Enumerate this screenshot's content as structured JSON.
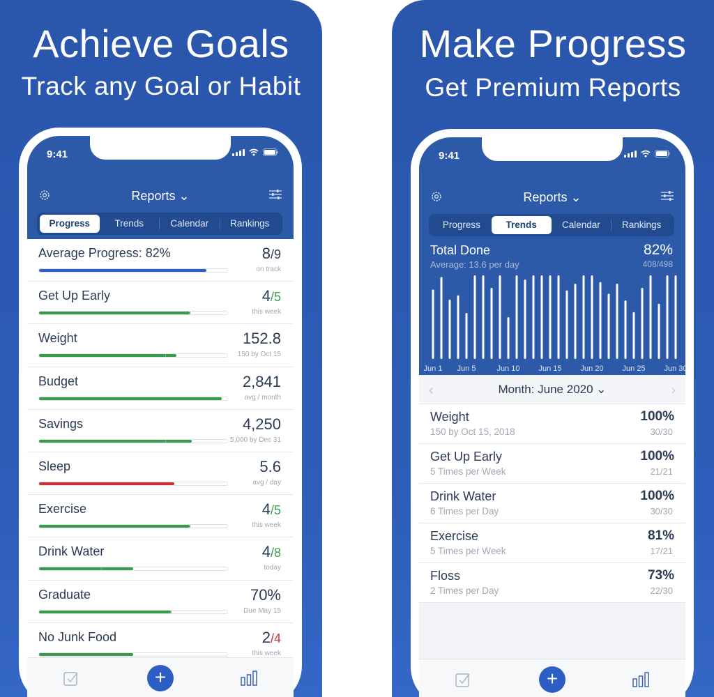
{
  "left": {
    "headline": "Achieve Goals",
    "subline": "Track any Goal or Habit",
    "status_time": "9:41",
    "title": "Reports",
    "tabs": [
      "Progress",
      "Trends",
      "Calendar",
      "Rankings"
    ],
    "active_tab": "Progress",
    "rows": [
      {
        "name": "Average Progress: 82%",
        "value": "8",
        "denom": "/9",
        "denom_style": "gray",
        "sub": "on track",
        "progress": 0.89,
        "color": "#2c5fc2",
        "tick": null
      },
      {
        "name": "Get Up Early",
        "value": "4",
        "denom": "/5",
        "denom_style": "green",
        "sub": "this week",
        "progress": 0.8,
        "color": "#3a9a4c",
        "tick": 0.8
      },
      {
        "name": "Weight",
        "value": "152.8",
        "denom": "",
        "denom_style": "gray",
        "sub": "150 by Oct 15",
        "progress": 0.73,
        "color": "#3a9a4c",
        "tick": 0.67
      },
      {
        "name": "Budget",
        "value": "2,841",
        "denom": "",
        "denom_style": "gray",
        "sub": "avg / month",
        "progress": 0.97,
        "color": "#3a9a4c",
        "tick": null
      },
      {
        "name": "Savings",
        "value": "4,250",
        "denom": "",
        "denom_style": "gray",
        "sub": "5,000 by Dec 31",
        "progress": 0.81,
        "color": "#3a9a4c",
        "tick": 0.67
      },
      {
        "name": "Sleep",
        "value": "5.6",
        "denom": "",
        "denom_style": "gray",
        "sub": "avg / day",
        "progress": 0.72,
        "color": "#c8323a",
        "tick": null
      },
      {
        "name": "Exercise",
        "value": "4",
        "denom": "/5",
        "denom_style": "green",
        "sub": "this week",
        "progress": 0.8,
        "color": "#3a9a4c",
        "tick": 0.8
      },
      {
        "name": "Drink Water",
        "value": "4",
        "denom": "/8",
        "denom_style": "green",
        "sub": "today",
        "progress": 0.5,
        "color": "#3a9a4c",
        "tick": 0.33
      },
      {
        "name": "Graduate",
        "value": "70%",
        "denom": "",
        "denom_style": "gray",
        "sub": "Due May 15",
        "progress": 0.7,
        "color": "#3a9a4c",
        "tick": 0.7
      },
      {
        "name": "No Junk Food",
        "value": "2",
        "denom": "/4",
        "denom_style": "red",
        "sub": "this week",
        "progress": 0.5,
        "color": "#3a9a4c",
        "tick": null
      }
    ]
  },
  "right": {
    "headline": "Make Progress",
    "subline": "Get Premium Reports",
    "status_time": "9:41",
    "title": "Reports",
    "tabs": [
      "Progress",
      "Trends",
      "Calendar",
      "Rankings"
    ],
    "active_tab": "Trends",
    "summary": {
      "title": "Total Done",
      "subtitle": "Average: 13.6 per day",
      "percent": "82%",
      "count": "408/498"
    },
    "month_label": "Month: June 2020",
    "ranking": [
      {
        "name": "Weight",
        "sub": "150 by Oct 15, 2018",
        "pct": "100%",
        "frac": "30/30"
      },
      {
        "name": "Get Up Early",
        "sub": "5 Times per Week",
        "pct": "100%",
        "frac": "21/21"
      },
      {
        "name": "Drink Water",
        "sub": "6 Times per Day",
        "pct": "100%",
        "frac": "30/30"
      },
      {
        "name": "Exercise",
        "sub": "5 Times per Week",
        "pct": "81%",
        "frac": "17/21"
      },
      {
        "name": "Floss",
        "sub": "2 Times per Day",
        "pct": "73%",
        "frac": "22/30"
      }
    ]
  },
  "chart_data": {
    "type": "bar",
    "categories": [
      "Jun 1",
      "Jun 2",
      "Jun 3",
      "Jun 4",
      "Jun 5",
      "Jun 6",
      "Jun 7",
      "Jun 8",
      "Jun 9",
      "Jun 10",
      "Jun 11",
      "Jun 12",
      "Jun 13",
      "Jun 14",
      "Jun 15",
      "Jun 16",
      "Jun 17",
      "Jun 18",
      "Jun 19",
      "Jun 20",
      "Jun 21",
      "Jun 22",
      "Jun 23",
      "Jun 24",
      "Jun 25",
      "Jun 26",
      "Jun 27",
      "Jun 28",
      "Jun 29",
      "Jun 30"
    ],
    "tick_labels": [
      "Jun 1",
      "Jun 5",
      "Jun 10",
      "Jun 15",
      "Jun 20",
      "Jun 25",
      "Jun 30"
    ],
    "values": [
      0.83,
      0.98,
      0.71,
      0.76,
      0.55,
      1.0,
      1.0,
      0.85,
      1.0,
      0.5,
      1.0,
      0.95,
      1.0,
      1.0,
      1.0,
      1.0,
      0.82,
      0.9,
      1.0,
      1.0,
      0.92,
      0.78,
      0.9,
      0.7,
      0.56,
      0.85,
      1.0,
      0.66,
      1.0,
      1.0
    ],
    "ylim": [
      0,
      1
    ]
  },
  "colors": {
    "brand": "#2d5aa8",
    "green": "#3a9a4c",
    "red": "#c8323a",
    "blue": "#2c5fc2"
  }
}
